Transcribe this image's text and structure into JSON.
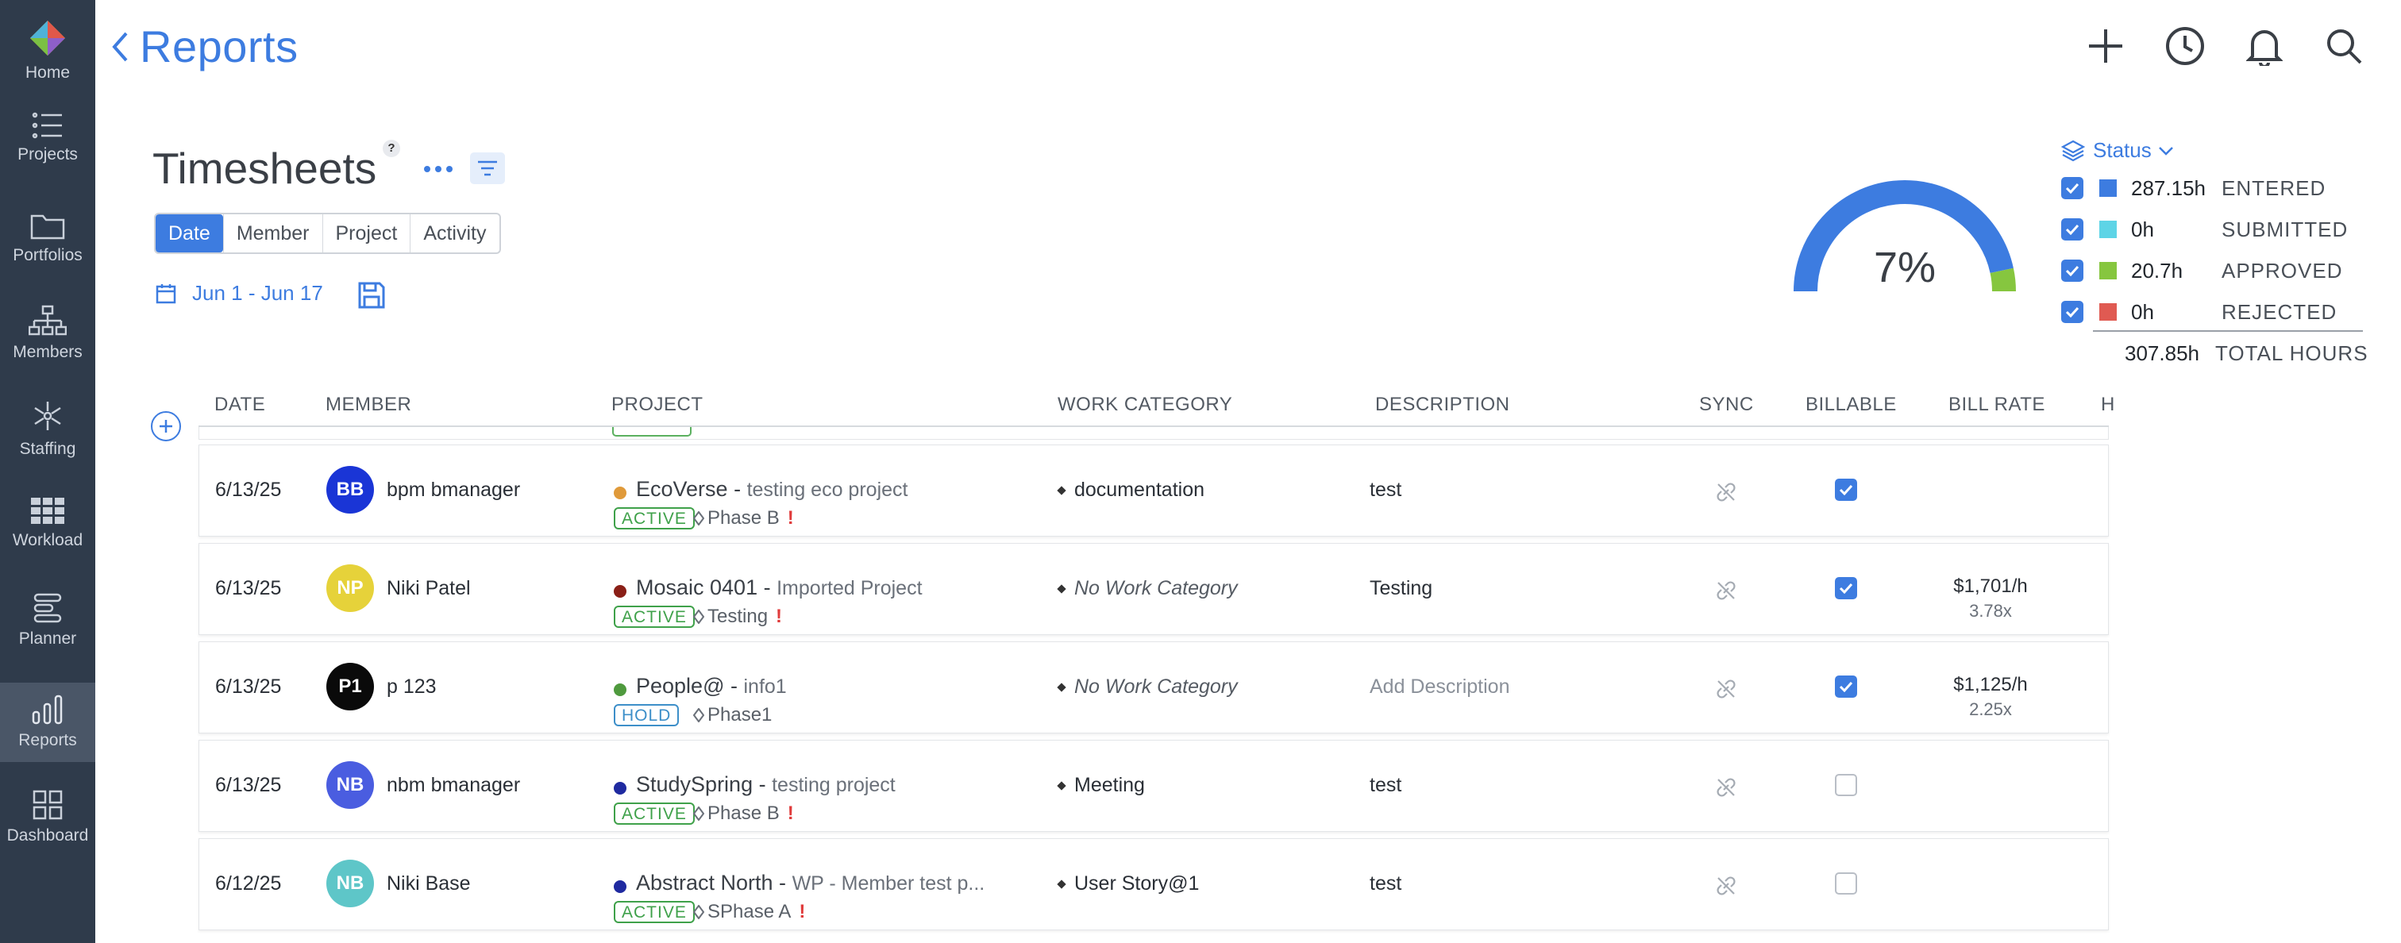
{
  "sidebar": {
    "items": [
      {
        "label": "Home",
        "icon": "logo-icon"
      },
      {
        "label": "Projects",
        "icon": "list-icon"
      },
      {
        "label": "Portfolios",
        "icon": "folder-icon"
      },
      {
        "label": "Members",
        "icon": "org-chart-icon"
      },
      {
        "label": "Staffing",
        "icon": "staffing-icon"
      },
      {
        "label": "Workload",
        "icon": "grid-icon"
      },
      {
        "label": "Planner",
        "icon": "planner-icon"
      },
      {
        "label": "Reports",
        "icon": "bar-chart-icon",
        "active": true
      },
      {
        "label": "Dashboard",
        "icon": "dashboard-icon"
      }
    ]
  },
  "header": {
    "back_label": "Reports",
    "icons": [
      "plus-icon",
      "clock-icon",
      "bell-icon",
      "search-icon"
    ]
  },
  "page": {
    "title": "Timesheets",
    "help": "?",
    "view_tabs": [
      "Date",
      "Member",
      "Project",
      "Activity"
    ],
    "active_tab": "Date",
    "date_range": "Jun 1 - Jun 17"
  },
  "summary": {
    "percent_label": "7%",
    "approved_fraction": 0.067,
    "status_label": "Status",
    "legend": [
      {
        "hours": "287.15h",
        "name": "ENTERED",
        "color": "#3d7ce0"
      },
      {
        "hours": "0h",
        "name": "SUBMITTED",
        "color": "#5ed4e6"
      },
      {
        "hours": "20.7h",
        "name": "APPROVED",
        "color": "#86c63f"
      },
      {
        "hours": "0h",
        "name": "REJECTED",
        "color": "#e05a52"
      }
    ],
    "total_hours": "307.85h",
    "total_label": "TOTAL HOURS"
  },
  "table": {
    "columns": [
      "DATE",
      "MEMBER",
      "PROJECT",
      "WORK CATEGORY",
      "DESCRIPTION",
      "SYNC",
      "BILLABLE",
      "BILL RATE",
      "H"
    ],
    "rows": [
      {
        "date": "6/13/25",
        "initials": "BB",
        "avatar_color": "#1a35d6",
        "avatar_text": "#ffffff",
        "member": "bpm bmanager",
        "project": "EcoVerse -",
        "project_sub": "testing eco project",
        "project_color": "#e09a3a",
        "status": "ACTIVE",
        "phase": "Phase B",
        "alert": "!",
        "work_category": "documentation",
        "wc_italic": false,
        "description": "test",
        "desc_placeholder": false,
        "billable": true,
        "rate": "",
        "multiplier": ""
      },
      {
        "date": "6/13/25",
        "initials": "NP",
        "avatar_color": "#e6d23a",
        "avatar_text": "#ffffff",
        "member": "Niki Patel",
        "project": "Mosaic 0401 -",
        "project_sub": "Imported Project",
        "project_color": "#8a1f17",
        "status": "ACTIVE",
        "phase": "Testing",
        "alert": "!",
        "work_category": "No Work Category",
        "wc_italic": true,
        "description": "Testing",
        "desc_placeholder": false,
        "billable": true,
        "rate": "$1,701/h",
        "multiplier": "3.78x"
      },
      {
        "date": "6/13/25",
        "initials": "P1",
        "avatar_color": "#0a0a0a",
        "avatar_text": "#ffffff",
        "member": "p 123",
        "project": "People@ -",
        "project_sub": "info1",
        "project_color": "#4f9a3e",
        "status": "HOLD",
        "phase": "Phase1",
        "alert": "",
        "work_category": "No Work Category",
        "wc_italic": true,
        "description": "Add Description",
        "desc_placeholder": true,
        "billable": true,
        "rate": "$1,125/h",
        "multiplier": "2.25x"
      },
      {
        "date": "6/13/25",
        "initials": "NB",
        "avatar_color": "#4a5de0",
        "avatar_text": "#ffffff",
        "member": "nbm bmanager",
        "project": "StudySpring -",
        "project_sub": "testing project",
        "project_color": "#1f2aa0",
        "status": "ACTIVE",
        "phase": "Phase B",
        "alert": "!",
        "work_category": "Meeting",
        "wc_italic": false,
        "description": "test",
        "desc_placeholder": false,
        "billable": false,
        "rate": "",
        "multiplier": ""
      },
      {
        "date": "6/12/25",
        "initials": "NB",
        "avatar_color": "#5ec6c8",
        "avatar_text": "#ffffff",
        "member": "Niki Base",
        "project": "Abstract North -",
        "project_sub": "WP - Member test p...",
        "project_color": "#1f2aa0",
        "status": "ACTIVE",
        "phase": "SPhase A",
        "alert": "!",
        "work_category": "User Story@1",
        "wc_italic": false,
        "description": "test",
        "desc_placeholder": false,
        "billable": false,
        "rate": "",
        "multiplier": ""
      }
    ]
  }
}
